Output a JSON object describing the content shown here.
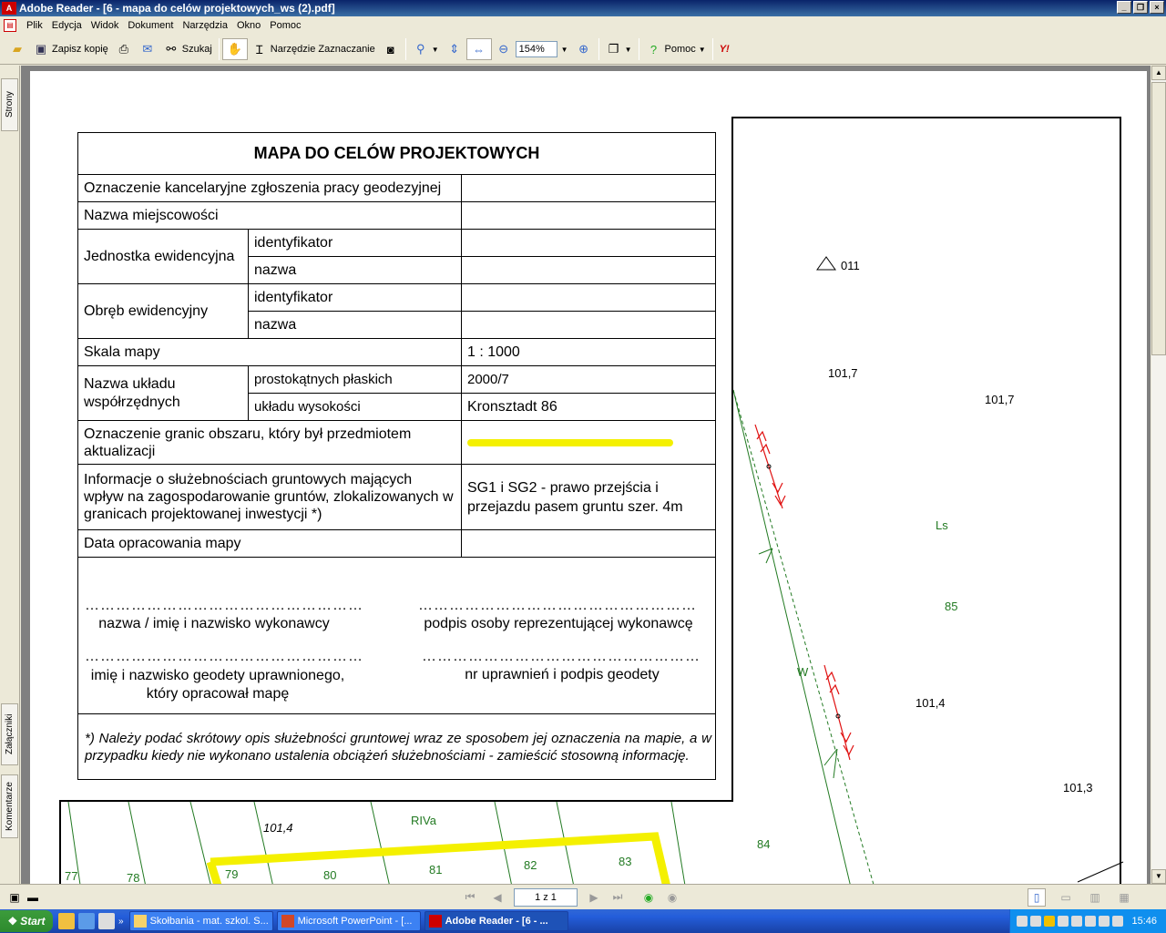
{
  "window": {
    "title": "Adobe Reader - [6 - mapa do celów projektowych_ws (2).pdf]"
  },
  "menu": [
    "Plik",
    "Edycja",
    "Widok",
    "Dokument",
    "Narzędzia",
    "Okno",
    "Pomoc"
  ],
  "toolbar": {
    "save_copy": "Zapisz kopię",
    "search": "Szukaj",
    "select_tool": "Narzędzie Zaznaczanie",
    "zoom": "154%",
    "help": "Pomoc",
    "yahoo": "Y!"
  },
  "side_tabs": {
    "pages": "Strony",
    "attachments": "Załączniki",
    "comments": "Komentarze"
  },
  "form": {
    "title": "MAPA DO CELÓW PROJEKTOWYCH",
    "r1": "Oznaczenie kancelaryjne zgłoszenia pracy geodezyjnej",
    "r2": "Nazwa miejscowości",
    "r3": "Jednostka ewidencyjna",
    "ident": "identyfikator",
    "name": "nazwa",
    "r4": "Obręb ewidencyjny",
    "r5": "Skala mapy",
    "r5v": "1 : 1000",
    "r6": "Nazwa układu współrzędnych",
    "r6a": "prostokątnych płaskich",
    "r6av": "2000/7",
    "r6b": "układu wysokości",
    "r6bv": "Kronsztadt 86",
    "r7": "Oznaczenie granic obszaru, który był przedmiotem aktualizacji",
    "r8": "Informacje o służebnościach gruntowych mających wpływ na zagospodarowanie gruntów, zlokalizowanych w granicach projektowanej inwestycji *)",
    "r8v": "SG1 i SG2 - prawo przejścia i przejazdu pasem gruntu szer. 4m",
    "r9": "Data opracowania mapy",
    "dots1": "………………………………………………",
    "sig1": "nazwa / imię i nazwisko wykonawcy",
    "sig2": "podpis osoby reprezentującej wykonawcę",
    "sig3": "imię i nazwisko geodety uprawnionego, który opracował mapę",
    "sig4": "nr uprawnień i podpis geodety",
    "note": "*) Należy podać skrótowy opis służebności gruntowej wraz ze sposobem jej oznaczenia na mapie, a w przypadku kiedy nie wykonano ustalenia obciążeń służebnościami - zamieścić stosowną informację."
  },
  "map_labels": {
    "pt011": "011",
    "h1": "101,7",
    "h2": "101,7",
    "h3": "101,4",
    "h4": "101,3",
    "h5": "101,4",
    "ls": "Ls",
    "p85": "85",
    "w": "W",
    "p84": "84",
    "riva": "RIVa",
    "p77": "77",
    "p78": "78",
    "p79": "79",
    "p80": "80",
    "p81": "81",
    "p82": "82",
    "p83": "83"
  },
  "status": {
    "page": "1 z 1"
  },
  "taskbar": {
    "start": "Start",
    "tasks": [
      "Skołbania - mat. szkol. S...",
      "Microsoft PowerPoint - [...",
      "Adobe Reader - [6 - ..."
    ],
    "clock": "15:46"
  },
  "colors": {
    "yellow_boundary": "#f4f000",
    "map_green": "#227a22",
    "easement_red": "#e01010"
  }
}
